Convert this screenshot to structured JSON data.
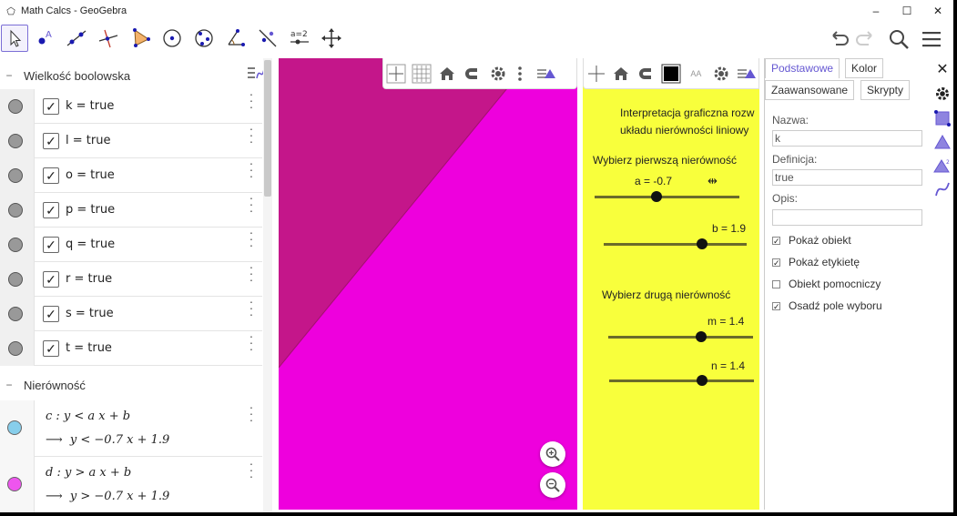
{
  "window": {
    "title": "Math Calcs - GeoGebra",
    "minimize": "–",
    "maximize": "☐",
    "close": "✕"
  },
  "toolbar": {
    "tools": [
      "move-tool",
      "point-tool",
      "line-tool",
      "perpendicular-tool",
      "polygon-tool",
      "circle-tool",
      "conic-tool",
      "angle-tool",
      "reflect-tool",
      "slider-tool",
      "move-view-tool"
    ],
    "slider_icon_text": "a=2",
    "right": [
      "undo",
      "redo",
      "search",
      "menu"
    ]
  },
  "algebra": {
    "group1": "Wielkość boolowska",
    "booleans": [
      {
        "label": "k = true"
      },
      {
        "label": "l = true"
      },
      {
        "label": "o = true"
      },
      {
        "label": "p = true"
      },
      {
        "label": "q = true"
      },
      {
        "label": "r = true"
      },
      {
        "label": "s = true"
      },
      {
        "label": "t = true"
      }
    ],
    "group2": "Nierówność",
    "inequalities": [
      {
        "definition": "c : y < a x + b",
        "output": "y < −0.7 x + 1.9",
        "color": "#87ceeb"
      },
      {
        "definition": "d : y > a x + b",
        "output": "y > −0.7 x + 1.9",
        "color": "#ee55ee"
      }
    ],
    "arrow": "⟶",
    "collapse": "−"
  },
  "graphics1": {
    "background": "#ee00dd",
    "region_color": "#c4168a",
    "zoom_in": "+",
    "zoom_out": "−"
  },
  "graphics2": {
    "background": "#f8ff3c",
    "line1": "Interpretacja graficzna rozw",
    "line2": "układu nierówności liniowy",
    "choose1": "Wybierz pierwszą nierówność",
    "choose2": "Wybierz drugą nierówność",
    "sliders": [
      {
        "label": "a = -0.7",
        "value": -0.7,
        "min": -5,
        "max": 5
      },
      {
        "label": "b = 1.9",
        "value": 1.9,
        "min": -5,
        "max": 5
      },
      {
        "label": "m = 1.4",
        "value": 1.4,
        "min": -5,
        "max": 5
      },
      {
        "label": "n = 1.4",
        "value": 1.4,
        "min": -5,
        "max": 5
      }
    ],
    "font_btn": "AA"
  },
  "props": {
    "tab_basic": "Podstawowe",
    "tab_color": "Kolor",
    "tab_advanced": "Zaawansowane",
    "tab_scripts": "Skrypty",
    "name_label": "Nazwa:",
    "name_value": "k",
    "definition_label": "Definicja:",
    "definition_value": "true",
    "caption_label": "Opis:",
    "caption_value": "",
    "checks": [
      {
        "label": "Pokaż obiekt",
        "checked": true
      },
      {
        "label": "Pokaż etykietę",
        "checked": true
      },
      {
        "label": "Obiekt pomocniczy",
        "checked": false
      },
      {
        "label": "Osadź pole wyboru",
        "checked": true
      }
    ],
    "close": "✕"
  },
  "colors": {
    "accent": "#6557d2",
    "tool_blue": "#1a1ab0",
    "tool_purple": "#6557d2"
  }
}
